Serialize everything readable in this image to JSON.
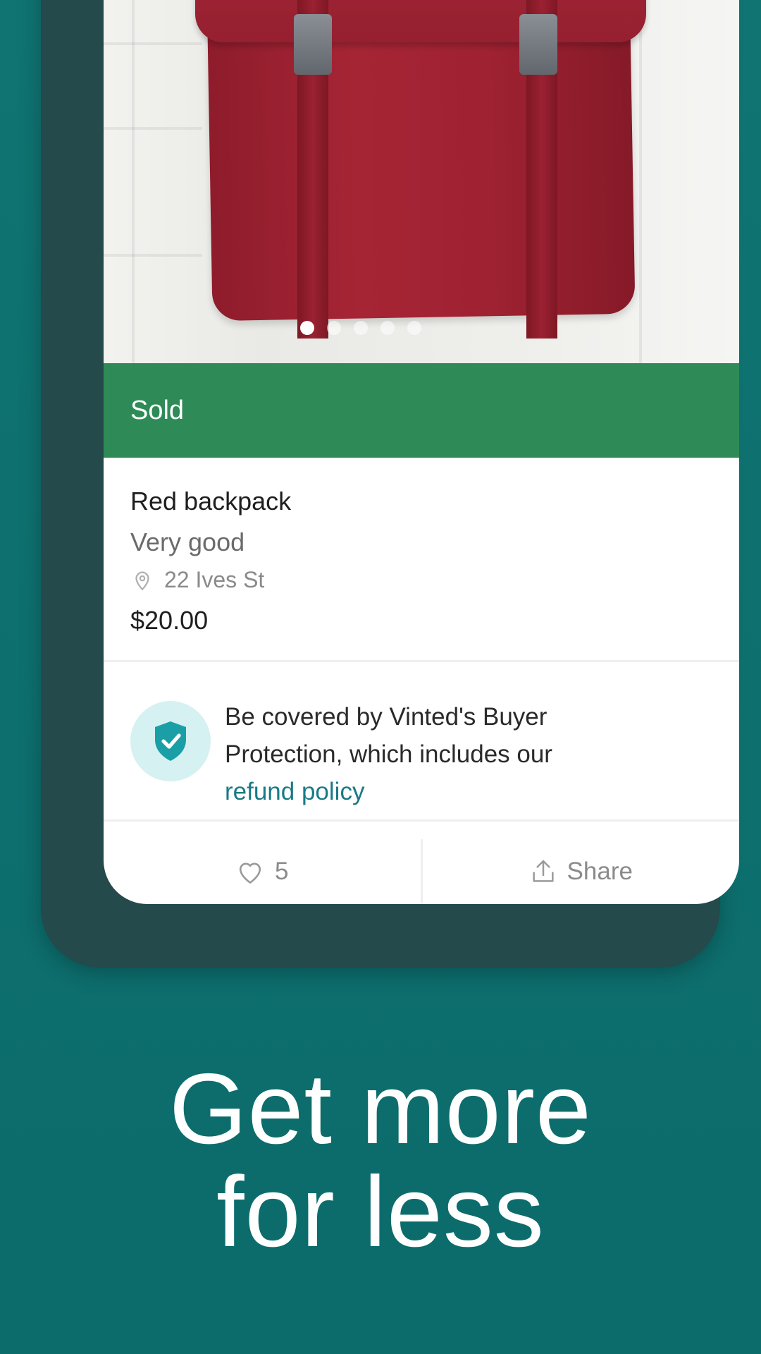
{
  "listing": {
    "status_label": "Sold",
    "title": "Red backpack",
    "condition": "Very good",
    "location": "22 Ives St",
    "price": "$20.00",
    "photo_count": 5,
    "active_photo_index": 0
  },
  "protection": {
    "text": "Be covered by Vinted's Buyer Protection, which includes our",
    "link_text": "refund policy"
  },
  "actions": {
    "favorites_count": "5",
    "share_label": "Share"
  },
  "promo": {
    "line1": "Get more",
    "line2": "for less"
  },
  "colors": {
    "background": "#0f7472",
    "sold_bar": "#2e8b57",
    "link": "#1a7a86",
    "shield_bg": "#d6f1f1",
    "shield": "#1a9fa6"
  },
  "icons": {
    "location": "location-pin-icon",
    "protection": "shield-check-icon",
    "favorite": "heart-icon",
    "share": "share-icon"
  }
}
